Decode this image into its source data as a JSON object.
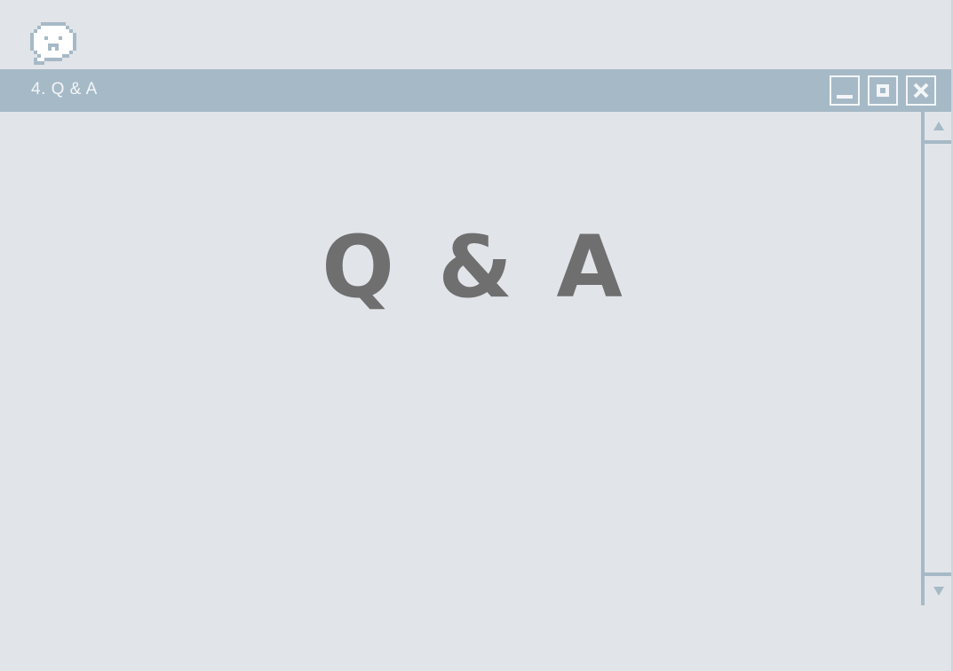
{
  "window": {
    "title": "4. Q & A",
    "app_icon": "pixel-chat-bubble-icon",
    "controls": {
      "minimize_icon": "minimize-icon",
      "maximize_icon": "maximize-icon",
      "close_icon": "close-icon"
    }
  },
  "scrollbar": {
    "up_icon": "scroll-up-arrow-icon",
    "down_icon": "scroll-down-arrow-icon"
  },
  "slide": {
    "heading": "Q & A"
  },
  "colors": {
    "background": "#e1e4e9",
    "title_bar": "#a6b9c6",
    "title_text": "#f3f6f8",
    "heading_text": "#6f6f6f"
  }
}
